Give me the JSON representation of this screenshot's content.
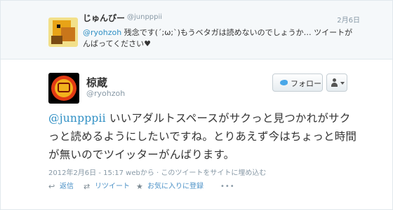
{
  "reply": {
    "name": "じゅんぴー",
    "handle": "@junpppii",
    "date": "2月6日",
    "mention": "@ryohzoh",
    "text": " 残念です(´;ω;`)もうベタガは読めないのでしょうか… ツイートがんばってください♥"
  },
  "tweet": {
    "name": "椋蔵",
    "handle": "@ryohzoh",
    "mention": "@junpppii",
    "text": " いいアダルトスペースがサクっと見つかれがサクっと読めるようにしたいですね。とりあえず今はちょっと時間が無いのでツイッターがんばります。",
    "timestamp": "2012年2月6日 - 15:17",
    "source_link": "webから",
    "separator": "·",
    "embed_link": "このツイートをサイトに埋め込む"
  },
  "buttons": {
    "follow_label": "フォロー"
  },
  "actions": {
    "reply_label": "返信",
    "retweet_label": "リツイート",
    "favorite_label": "お気に入りに登録",
    "more_label": "•••"
  },
  "icons": {
    "reply": "reply-arrow-icon",
    "retweet": "retweet-icon",
    "favorite": "star-icon",
    "follow": "twitter-bird-icon",
    "user_menu": "user-icon"
  },
  "colors": {
    "link": "#2f8fc4",
    "muted": "#8899a6",
    "reply_bg": "#f5f8fa"
  }
}
